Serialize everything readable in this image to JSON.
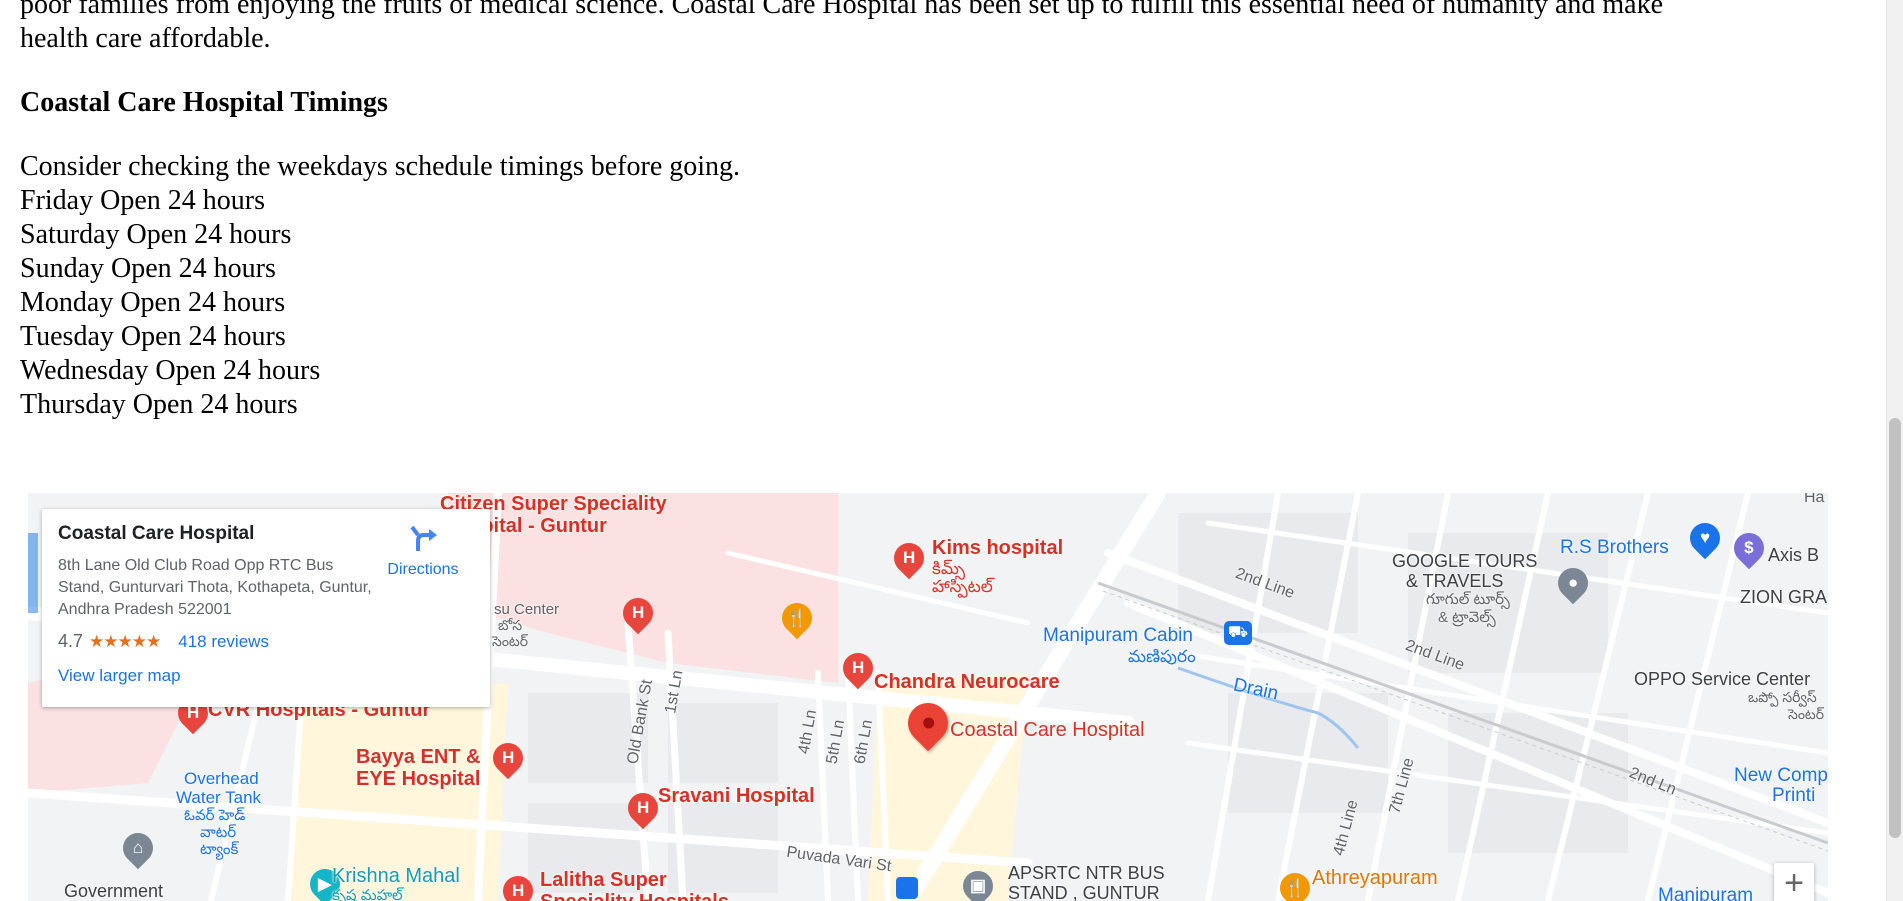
{
  "article": {
    "intro_line1": "poor families from enjoying the fruits of medical science. Coastal Care Hospital has been set up to fulfill this essential need of humanity and make",
    "intro_line2": "health care affordable.",
    "timings_heading": "Coastal Care Hospital Timings",
    "schedule_intro": "Consider checking the weekdays schedule timings before going.",
    "schedule": [
      {
        "day": "Friday",
        "hours": "Open 24 hours"
      },
      {
        "day": "Saturday",
        "hours": "Open 24 hours"
      },
      {
        "day": "Sunday",
        "hours": "Open 24 hours"
      },
      {
        "day": "Monday",
        "hours": "Open 24 hours"
      },
      {
        "day": "Tuesday",
        "hours": "Open 24 hours"
      },
      {
        "day": "Wednesday",
        "hours": "Open 24 hours"
      },
      {
        "day": "Thursday",
        "hours": "Open 24 hours"
      }
    ]
  },
  "map_card": {
    "title": "Coastal Care Hospital",
    "address": "8th Lane Old Club Road Opp RTC Bus Stand, Gunturvari Thota, Kothapeta, Guntur, Andhra Pradesh 522001",
    "rating": "4.7",
    "stars": "★★★★★",
    "reviews": "418 reviews",
    "view_larger": "View larger map",
    "directions": "Directions"
  },
  "map_labels": {
    "citizen": "Citizen Super Speciality",
    "citizen2": "ospital - Guntur",
    "kims": "Kims hospital",
    "kims_te1": "కిమ్స్",
    "kims_te2": "హాస్పిటల్",
    "chandra": "Chandra Neurocare",
    "coastal": "Coastal Care Hospital",
    "cvr": "CVR Hospitals - Guntur",
    "bayya1": "Bayya ENT &",
    "bayya2": "EYE Hospital",
    "sravani": "Sravani Hospital",
    "lalitha1": "Lalitha Super",
    "lalitha2": "Speciality Hospitals",
    "manipuram": "Manipuram Cabin",
    "manipuram_te": "మణిపురం",
    "drain": "Drain",
    "google_tours1": "GOOGLE TOURS",
    "google_tours2": "& TRAVELS",
    "google_tours_te1": "గూగుల్ టూర్స్",
    "google_tours_te2": "& ట్రావెల్స్",
    "rs_brothers": "R.S Brothers",
    "axis": "Axis B",
    "zion": "ZION GRA",
    "oppo": "OPPO Service Center",
    "oppo_te1": "ఒప్పో సర్వీస్",
    "oppo_te2": "సెంటర్",
    "new_comp1": "New Comp",
    "new_comp2": "Printi",
    "overhead1": "Overhead",
    "overhead2": "Water Tank",
    "overhead_te1": "ఓవర్ హెడ్",
    "overhead_te2": "వాటర్",
    "overhead_te3": "ట్యాంక్",
    "krishna": "Krishna Mahal",
    "krishna_te": "కృష్ణ మహల్",
    "government": "Government",
    "apsrtc1": "APSRTC NTR BUS",
    "apsrtc2": "STAND , GUNTUR",
    "athreya": "Athreyapuram",
    "manipuram_bottom": "Manipuram",
    "bus_center1": "su Center",
    "bus_center2": "బోస",
    "bus_center3": "సెంటర్",
    "ha": "Ha"
  },
  "streets": {
    "old_bank": "Old Bank St",
    "first_ln": "1st Ln",
    "fourth_ln": "4th Ln",
    "fifth_ln": "5th Ln",
    "sixth_ln": "6th Ln",
    "second_line_a": "2nd Line",
    "second_line_b": "2nd Line",
    "seventh_line": "7th Line",
    "fourth_line": "4th Line",
    "second_ln": "2nd Ln",
    "puvada": "Puvada Vari St"
  },
  "zoom": {
    "plus": "+"
  }
}
